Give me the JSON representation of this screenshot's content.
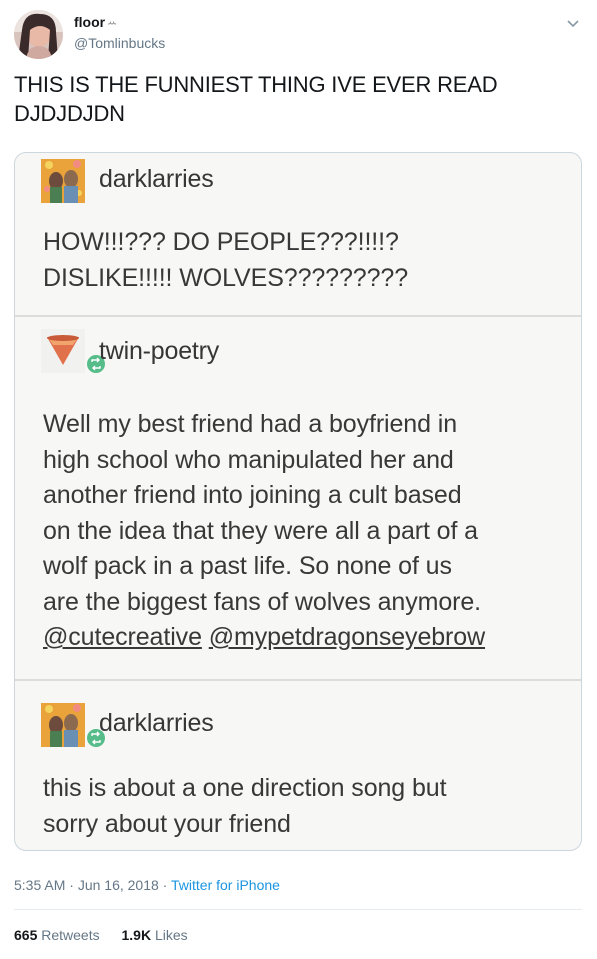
{
  "tweet": {
    "display_name": "floor",
    "name_sparkles": "ꕀ",
    "handle": "@Tomlinbucks",
    "text_line1": "THIS IS THE FUNNIEST THING IVE EVER READ",
    "text_line2": "DJDJDJDN",
    "time": "5:35 AM",
    "date": "Jun 16, 2018",
    "source": "Twitter for iPhone",
    "retweets_count": "665",
    "retweets_label": "Retweets",
    "likes_count": "1.9K",
    "likes_label": "Likes",
    "menu_icon": "chevron-down-icon"
  },
  "screenshot": {
    "posts": [
      {
        "blog": "darklarries",
        "lines": [
          "HOW!!!??? DO PEOPLE???!!!!?",
          "DISLIKE!!!!! WOLVES?????????"
        ]
      },
      {
        "blog": "twin-poetry",
        "lines": [
          "Well my best friend had a boyfriend in",
          "high school who manipulated her and",
          "another friend into joining a cult based",
          "on the idea that they were all a part of a",
          "wolf pack in a past life. So none of us",
          "are the biggest fans of wolves anymore."
        ],
        "mention1": "@cutecreative",
        "mention2": "@mypetdragonseyebrow"
      },
      {
        "blog": "darklarries",
        "lines": [
          "this is about a one direction song but",
          "sorry about your friend"
        ]
      }
    ]
  },
  "colors": {
    "link": "#1b95e0",
    "reblog_green": "#56bc8a",
    "secondary_text": "#657786"
  }
}
